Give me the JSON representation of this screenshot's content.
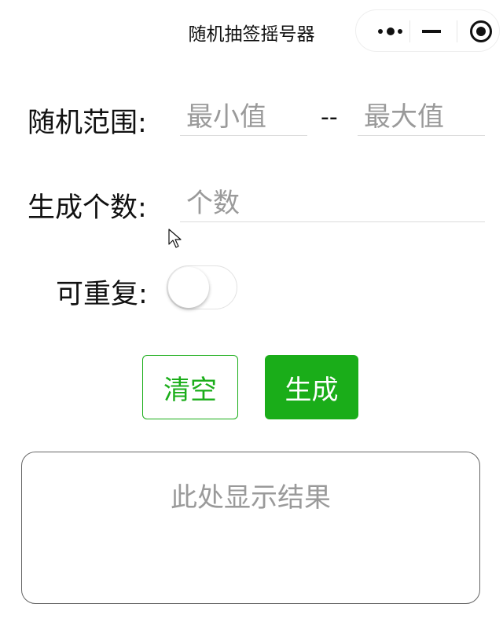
{
  "navbar": {
    "title": "随机抽签摇号器",
    "capsule": {
      "more_icon": "more-dots-icon",
      "minimize_icon": "minimize-icon",
      "close_icon": "target-close-icon"
    }
  },
  "form": {
    "range_label": "随机范围:",
    "min_placeholder": "最小值",
    "range_separator": "--",
    "max_placeholder": "最大值",
    "count_label": "生成个数:",
    "count_placeholder": "个数",
    "repeat_label": "可重复:",
    "repeat_enabled": false
  },
  "actions": {
    "clear_label": "清空",
    "generate_label": "生成"
  },
  "result": {
    "placeholder": "此处显示结果"
  },
  "colors": {
    "accent": "#1aad19",
    "placeholder": "#9a9a9a",
    "text": "#111111"
  }
}
